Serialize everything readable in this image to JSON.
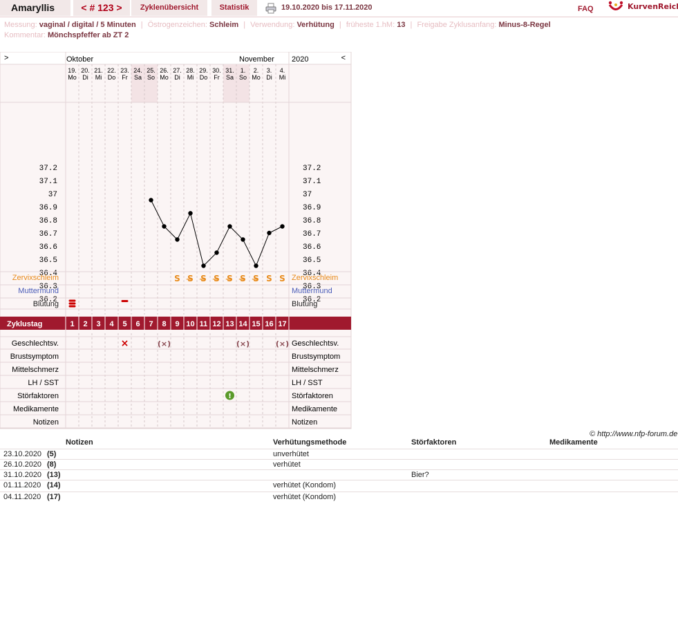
{
  "header": {
    "user_name": "Amaryllis",
    "cycle_prev": "<",
    "cycle_label": "# 123",
    "cycle_next": ">",
    "overview_label": "Zyklenübersicht",
    "stats_label": "Statistik",
    "date_range": "19.10.2020 bis 17.11.2020",
    "faq_label": "FAQ",
    "logo_text": "KurvenReich"
  },
  "info": {
    "messung_label": "Messung:",
    "messung_value": "vaginal / digital / 5 Minuten",
    "oestrogen_label": "Östrogenzeichen:",
    "oestrogen_value": "Schleim",
    "verwendung_label": "Verwendung:",
    "verwendung_value": "Verhütung",
    "hm_label": "früheste 1.hM:",
    "hm_value": "13",
    "freigabe_label": "Freigabe Zyklusanfang:",
    "freigabe_value": "Minus-8-Regel",
    "kommentar_label": "Kommentar:",
    "kommentar_value": "Mönchspfeffer ab ZT 2"
  },
  "chart_data": {
    "type": "line",
    "title": "",
    "nav_left": ">",
    "nav_right": "<",
    "month_labels": [
      "Oktober",
      "November"
    ],
    "year": "2020",
    "dates": [
      "19.",
      "20.",
      "21.",
      "22.",
      "23.",
      "24.",
      "25.",
      "26.",
      "27.",
      "28.",
      "29.",
      "30.",
      "31.",
      "1.",
      "2.",
      "3.",
      "4."
    ],
    "weekdays": [
      "Mo",
      "Di",
      "Mi",
      "Do",
      "Fr",
      "Sa",
      "So",
      "Mo",
      "Di",
      "Mi",
      "Do",
      "Fr",
      "Sa",
      "So",
      "Mo",
      "Di",
      "Mi"
    ],
    "weekend_days": [
      6,
      7,
      13,
      14
    ],
    "cycle_days": [
      1,
      2,
      3,
      4,
      5,
      6,
      7,
      8,
      9,
      10,
      11,
      12,
      13,
      14,
      15,
      16,
      17
    ],
    "y_ticks": [
      "37.2",
      "37.1",
      "37",
      "36.9",
      "36.8",
      "36.7",
      "36.6",
      "36.5",
      "36.4",
      "36.3",
      "36.2"
    ],
    "ylim": [
      36.2,
      37.2
    ],
    "series": [
      {
        "values": [
          null,
          null,
          null,
          null,
          null,
          null,
          36.95,
          36.75,
          36.65,
          36.85,
          36.45,
          36.55,
          36.75,
          36.65,
          36.45,
          36.7,
          36.75
        ],
        "color": "#000000"
      }
    ],
    "zervixschleim": [
      null,
      null,
      null,
      null,
      null,
      null,
      null,
      null,
      "S",
      "S̶",
      "S̶",
      "S̶",
      "S̶",
      "S̶",
      "S̶",
      "S",
      "S"
    ],
    "blutung": [
      {
        "day": 1,
        "kind": "stark"
      },
      {
        "day": 5,
        "kind": "schmier"
      }
    ],
    "geschlechtsverkehr": [
      {
        "day": 5,
        "symbol": "×",
        "protected": false
      },
      {
        "day": 8,
        "symbol": "(×)",
        "protected": true
      },
      {
        "day": 14,
        "symbol": "(×)",
        "protected": true
      },
      {
        "day": 17,
        "symbol": "(×)",
        "protected": true
      }
    ],
    "stoerfaktoren_days": [
      13
    ],
    "row_labels": {
      "zervix": "Zervixschleim",
      "muttermund": "Muttermund",
      "blutung": "Blutung",
      "zyklustag": "Zyklustag",
      "gv": "Geschlechtsv.",
      "brust": "Brustsymptom",
      "mittel": "Mittelschmerz",
      "lh": "LH / SST",
      "stoer": "Störfaktoren",
      "medi": "Medikamente",
      "notizen": "Notizen"
    },
    "colors": {
      "zervix": "#e88a1a",
      "muttermund": "#4a5cb8",
      "zyklustag_bar": "#a0192e",
      "blutung": "#cc0000",
      "gv": "#cc0000",
      "gv_protected": "#8a4a52",
      "stoer": "#5a9a2a",
      "weekend": "#f3e3e5",
      "panel": "#fbf5f5"
    }
  },
  "copyright": "© http://www.nfp-forum.de",
  "notes": {
    "headers": [
      "Notizen",
      "Verhütungsmethode",
      "Störfaktoren",
      "Medikamente"
    ],
    "rows": [
      {
        "date": "23.10.2020",
        "day": "(5)",
        "method": "unverhütet",
        "stoer": ""
      },
      {
        "date": "26.10.2020",
        "day": "(8)",
        "method": "verhütet",
        "stoer": ""
      },
      {
        "date": "31.10.2020",
        "day": "(13)",
        "method": "",
        "stoer": "Bier?"
      },
      {
        "date": "01.11.2020",
        "day": "(14)",
        "method": "verhütet (Kondom)",
        "stoer": ""
      },
      {
        "date": "04.11.2020",
        "day": "(17)",
        "method": "verhütet (Kondom)",
        "stoer": ""
      }
    ]
  }
}
